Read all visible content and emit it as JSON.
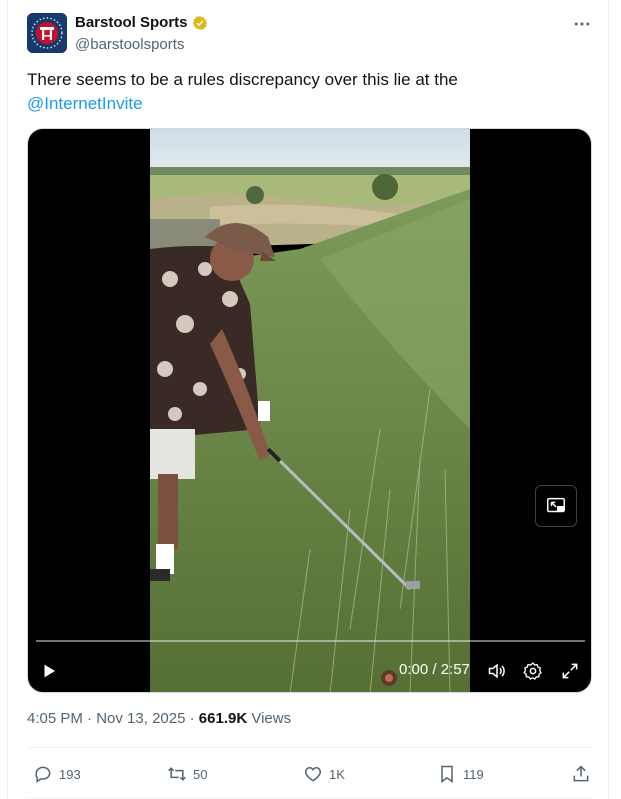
{
  "author": {
    "display_name": "Barstool Sports",
    "handle": "@barstoolsports",
    "verified_color": "#e2b719"
  },
  "tweet": {
    "text": "There seems to be a rules discrepancy over this lie at the",
    "mention": "@InternetInvite"
  },
  "video": {
    "current_time": "0:00",
    "duration": "2:57",
    "time_display": "0:00 / 2:57",
    "progress": 0.0
  },
  "meta": {
    "time": "4:05 PM",
    "separator": "·",
    "date": "Nov 13, 2025",
    "views_count": "661.9K",
    "views_label": "Views"
  },
  "actions": {
    "replies": "193",
    "reposts": "50",
    "likes": "1K",
    "bookmarks": "119"
  },
  "icons": {
    "more": "more-dots-icon",
    "verified": "verified-badge-icon",
    "play": "play-icon",
    "volume": "volume-icon",
    "settings": "gear-icon",
    "fullscreen": "fullscreen-icon",
    "pip": "picture-in-picture-icon",
    "reply": "reply-icon",
    "repost": "repost-icon",
    "like": "heart-icon",
    "bookmark": "bookmark-icon",
    "share": "share-icon"
  },
  "colors": {
    "accent": "#1d9bf0",
    "text_primary": "#0f1419",
    "text_secondary": "#536471"
  }
}
